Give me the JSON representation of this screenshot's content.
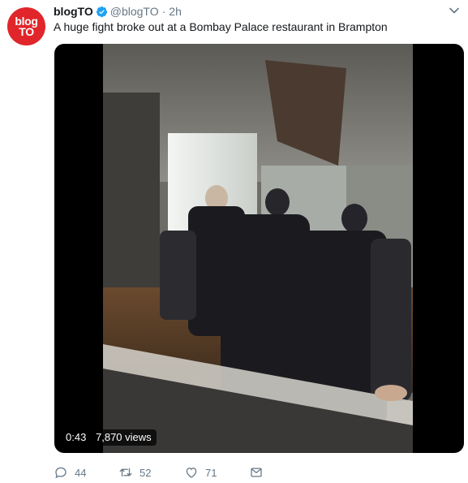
{
  "avatar": {
    "line1": "blog",
    "line2": "TO",
    "color": "#e0262b"
  },
  "tweet": {
    "display_name": "blogTO",
    "handle": "@blogTO",
    "separator": "·",
    "time": "2h",
    "text": "A huge fight broke out at a Bombay Palace restaurant in Brampton"
  },
  "video": {
    "duration": "0:43",
    "views": "7,870 views"
  },
  "actions": {
    "replies": "44",
    "retweets": "52",
    "likes": "71"
  },
  "icons": {
    "verified": "verified-badge-icon",
    "menu": "chevron-down-icon",
    "reply": "reply-icon",
    "retweet": "retweet-icon",
    "like": "heart-icon",
    "dm": "envelope-icon"
  },
  "colors": {
    "verified": "#1da1f2",
    "muted": "#657786",
    "text": "#14171a"
  }
}
